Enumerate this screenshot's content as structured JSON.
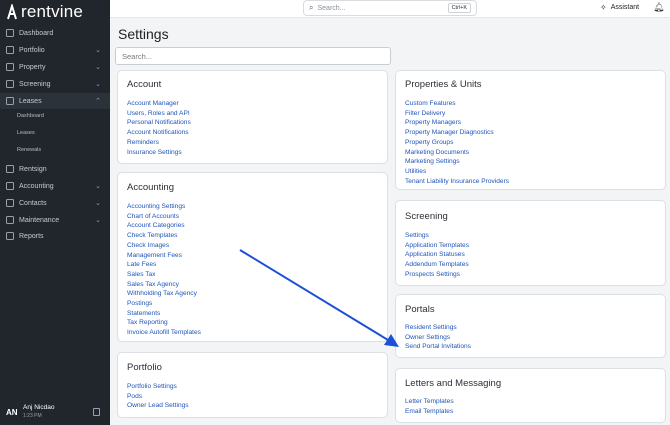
{
  "brand": {
    "name": "rentvine"
  },
  "sidebar": {
    "items": [
      {
        "label": "Dashboard"
      },
      {
        "label": "Portfolio"
      },
      {
        "label": "Property"
      },
      {
        "label": "Screening"
      },
      {
        "label": "Leases"
      },
      {
        "label": "Rentsign"
      },
      {
        "label": "Accounting"
      },
      {
        "label": "Contacts"
      },
      {
        "label": "Maintenance"
      },
      {
        "label": "Reports"
      }
    ],
    "leases_sub": [
      "Dashboard",
      "Leases",
      "Renewals"
    ],
    "user": {
      "initials": "AN",
      "name": "Anj Nicdao",
      "time": "1:23 PM"
    }
  },
  "topbar": {
    "search_placeholder": "Search...",
    "shortcut": "Ctrl+K",
    "assistant": "Assistant"
  },
  "page": {
    "title": "Settings",
    "search_placeholder": "Search..."
  },
  "cards": {
    "account": {
      "title": "Account",
      "links": [
        "Account Manager",
        "Users, Roles and API",
        "Personal Notifications",
        "Account Notifications",
        "Reminders",
        "Insurance Settings"
      ]
    },
    "accounting": {
      "title": "Accounting",
      "links": [
        "Accounting Settings",
        "Chart of Accounts",
        "Account Categories",
        "Check Templates",
        "Check Images",
        "Management Fees",
        "Late Fees",
        "Sales Tax",
        "Sales Tax Agency",
        "Withholding Tax Agency",
        "Postings",
        "Statements",
        "Tax Reporting",
        "Invoice Autofill Templates"
      ]
    },
    "portfolio": {
      "title": "Portfolio",
      "links": [
        "Portfolio Settings",
        "Pods",
        "Owner Lead Settings"
      ]
    },
    "properties": {
      "title": "Properties & Units",
      "links": [
        "Custom Features",
        "Filter Delivery",
        "Property Managers",
        "Property Manager Diagnostics",
        "Property Groups",
        "Marketing Documents",
        "Marketing Settings",
        "Utilities",
        "Tenant Liability Insurance Providers"
      ]
    },
    "screening": {
      "title": "Screening",
      "links": [
        "Settings",
        "Application Templates",
        "Application Statuses",
        "Addendum Templates",
        "Prospects Settings"
      ]
    },
    "portals": {
      "title": "Portals",
      "links": [
        "Resident Settings",
        "Owner Settings",
        "Send Portal Invitations"
      ]
    },
    "letters": {
      "title": "Letters and Messaging",
      "links": [
        "Letter Templates",
        "Email Templates"
      ]
    }
  },
  "colors": {
    "sidebar_bg": "#21262d",
    "link": "#1f55b8",
    "arrow": "#1b4fd6"
  }
}
